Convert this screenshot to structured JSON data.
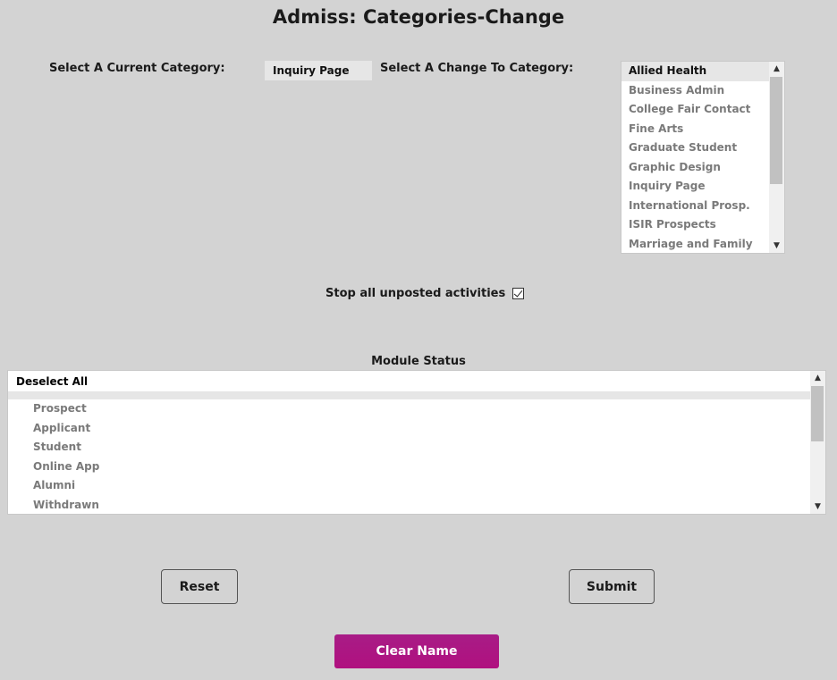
{
  "page": {
    "title": "Admiss: Categories-Change"
  },
  "current_category": {
    "label": "Select A Current Category:",
    "value": "Inquiry Page"
  },
  "change_category": {
    "label": "Select A Change To Category:",
    "options": [
      "Allied Health",
      "Business Admin",
      "College Fair Contact",
      "Fine Arts",
      "Graduate Student",
      "Graphic Design",
      "Inquiry Page",
      "International Prosp.",
      "ISIR Prospects",
      "Marriage and Family"
    ],
    "selected": "Allied Health"
  },
  "stop_activities": {
    "label": "Stop all unposted activities",
    "checked": true
  },
  "module_status": {
    "title": "Module Status",
    "deselect_label": "Deselect All",
    "items": [
      "Prospect",
      "Applicant",
      "Student",
      "Online App",
      "Alumni",
      "Withdrawn"
    ]
  },
  "buttons": {
    "reset": "Reset",
    "submit": "Submit",
    "clear_name": "Clear Name"
  },
  "colors": {
    "background": "#d3d3d3",
    "clear_button": "#b0107f"
  }
}
